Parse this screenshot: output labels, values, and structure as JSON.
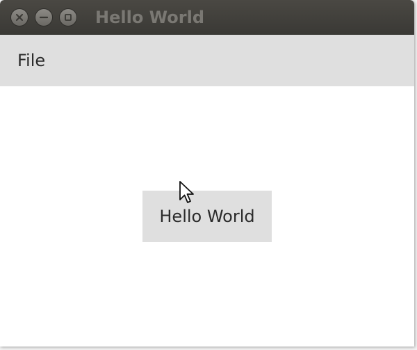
{
  "window": {
    "title": "Hello World"
  },
  "menubar": {
    "items": [
      {
        "label": "File"
      }
    ]
  },
  "main": {
    "button_label": "Hello World"
  },
  "icons": {
    "close": "close-icon",
    "minimize": "minimize-icon",
    "maximize": "maximize-icon",
    "cursor": "mouse-pointer-icon"
  },
  "colors": {
    "titlebar": "#3c3b37",
    "menubar": "#dfdfdf",
    "button": "#dfdfdf",
    "content": "#ffffff"
  }
}
